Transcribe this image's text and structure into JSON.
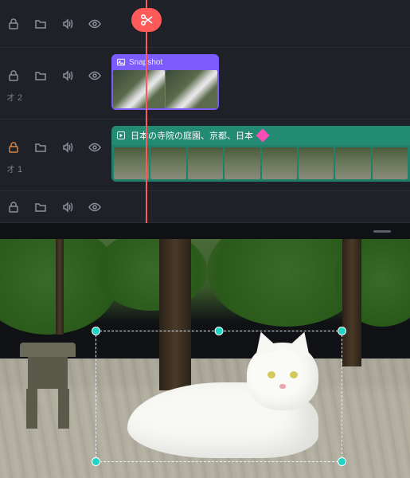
{
  "timeline": {
    "tracks": [
      {
        "label": ""
      },
      {
        "label": "オ 2",
        "clip": {
          "title": "Snapshot"
        }
      },
      {
        "label": "オ 1",
        "clip": {
          "title": "日本の寺院の庭園、京都、日本"
        }
      },
      {
        "label": ""
      }
    ]
  },
  "icons": {
    "lock": "lock",
    "folder": "folder",
    "speaker": "speaker",
    "eye": "eye",
    "image": "image",
    "play": "play",
    "scissors": "scissors",
    "diamond": "diamond"
  }
}
